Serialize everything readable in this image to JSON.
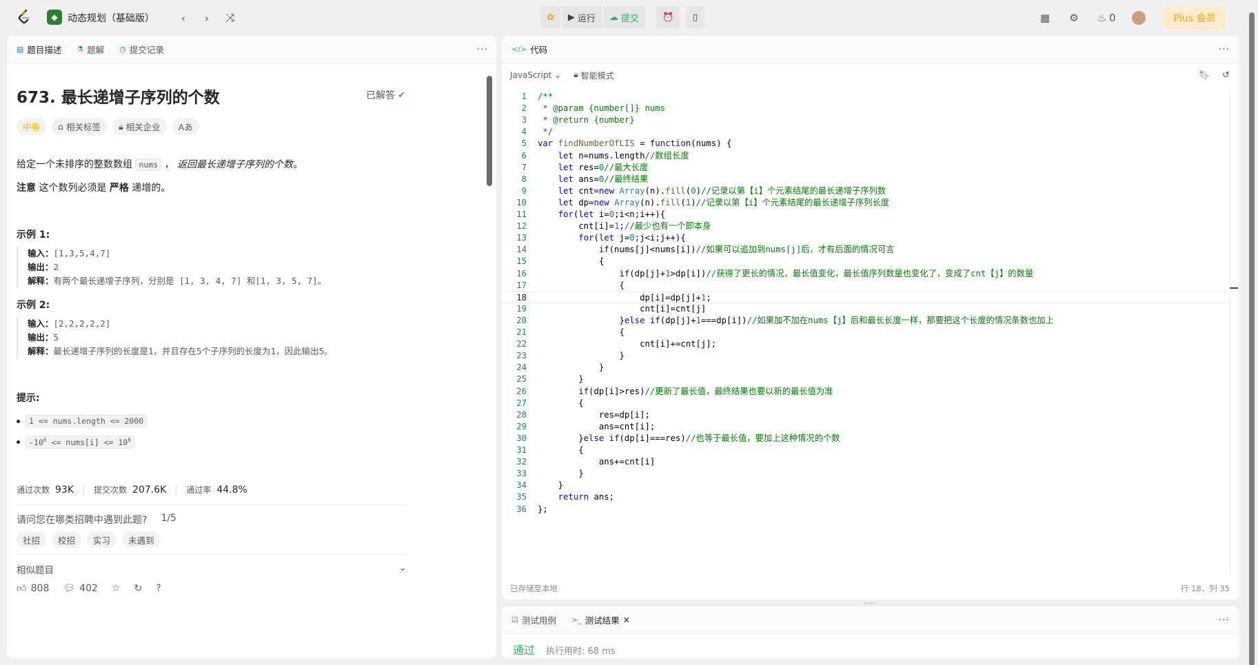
{
  "topbar": {
    "list_title": "动态规划（基础版）",
    "run_label": "运行",
    "submit_label": "提交",
    "streak_count": "0",
    "plus_label": "Plus 会员"
  },
  "left_tabs": {
    "description": "题目描述",
    "solutions": "题解",
    "submissions": "提交记录"
  },
  "problem": {
    "title": "673. 最长递增子序列的个数",
    "status": "已解答",
    "difficulty": "中等",
    "tag_topics": "相关标签",
    "tag_companies": "相关企业",
    "tag_font": "Aあ",
    "desc_prefix": "给定一个未排序的整数数组",
    "desc_code": "nums",
    "desc_sep": "，",
    "desc_suffix": "返回最长递增子序列的个数",
    "desc_end": "。",
    "note_bold": "注意",
    "note_text": "这个数列必须是",
    "note_strict": "严格",
    "note_end": "递增的。",
    "example1_title": "示例 1:",
    "example1_input_label": "输入：",
    "example1_input": "[1,3,5,4,7]",
    "example1_output_label": "输出：",
    "example1_output": "2",
    "example1_explain_label": "解释：",
    "example1_explain": "有两个最长递增子序列，分别是 [1, 3, 4, 7] 和[1, 3, 5, 7]。",
    "example2_title": "示例 2:",
    "example2_input_label": "输入：",
    "example2_input": "[2,2,2,2,2]",
    "example2_output_label": "输出：",
    "example2_output": "5",
    "example2_explain_label": "解释：",
    "example2_explain": "最长递增子序列的长度是1，并且存在5个子序列的长度为1，因此输出5。",
    "hints_title": "提示:",
    "constraint1": "1 <= nums.length <= 2000",
    "constraint2_pre": "-10",
    "constraint2_exp": "6",
    "constraint2_mid": " <= nums[i] <= 10",
    "constraint2_exp2": "6"
  },
  "stats": {
    "accepted_label": "通过次数",
    "accepted": "93K",
    "submissions_label": "提交次数",
    "submissions": "207.6K",
    "rate_label": "通过率",
    "rate": "44.8%"
  },
  "survey": {
    "question": "请问您在哪类招聘中遇到此题?",
    "progress": "1/5",
    "options": [
      "社招",
      "校招",
      "实习",
      "未遇到"
    ]
  },
  "similar_label": "相似题目",
  "actions": {
    "likes": "808",
    "comments": "402"
  },
  "code_panel": {
    "tab": "代码",
    "language": "JavaScript",
    "mode": "智能模式",
    "saved": "已存储至本地",
    "cursor": "行 18，列 35"
  },
  "code_lines": [
    "/**",
    " * @param {number[]} nums",
    " * @return {number}",
    " */",
    "var findNumberOfLIS = function(nums) {",
    "    let n=nums.length//数组长度",
    "    let res=0//最大长度",
    "    let ans=0//最终结果",
    "    let cnt=new Array(n).fill(0)//记录以第【i】个元素结尾的最长递增子序列数",
    "    let dp=new Array(n).fill(1)//记录以第【i】个元素结尾的最长递增子序列长度",
    "    for(let i=0;i<n;i++){",
    "        cnt[i]=1;//最少也有一个即本身",
    "        for(let j=0;j<i;j++){",
    "            if(nums[j]<nums[i])//如果可以追加到nums[j]后，才有后面的情况可言",
    "            {",
    "                if(dp[j]+1>dp[i])//获得了更长的情况，最长值变化，最长值序列数量也变化了，变成了cnt【j】的数量",
    "                {",
    "                    dp[i]=dp[j]+1;",
    "                    cnt[i]=cnt[j]",
    "                }else if(dp[j]+1===dp[i])//如果加不加在nums【j】后和最长长度一样，那要把这个长度的情况条数也加上",
    "                {",
    "                    cnt[i]+=cnt[j];",
    "                }",
    "            }",
    "        }",
    "        if(dp[i]>res)//更新了最长值，最终结果也要以新的最长值为准",
    "        {",
    "            res=dp[i];",
    "            ans=cnt[i];",
    "        }else if(dp[i]===res)//也等于最长值，要加上这种情况的个数",
    "        {",
    "            ans+=cnt[i]",
    "        }",
    "    }",
    "    return ans;",
    "};"
  ],
  "current_line": 18,
  "test_panel": {
    "tab_cases": "测试用例",
    "tab_results": "测试结果",
    "result": "通过",
    "time": "执行用时: 68 ms"
  }
}
